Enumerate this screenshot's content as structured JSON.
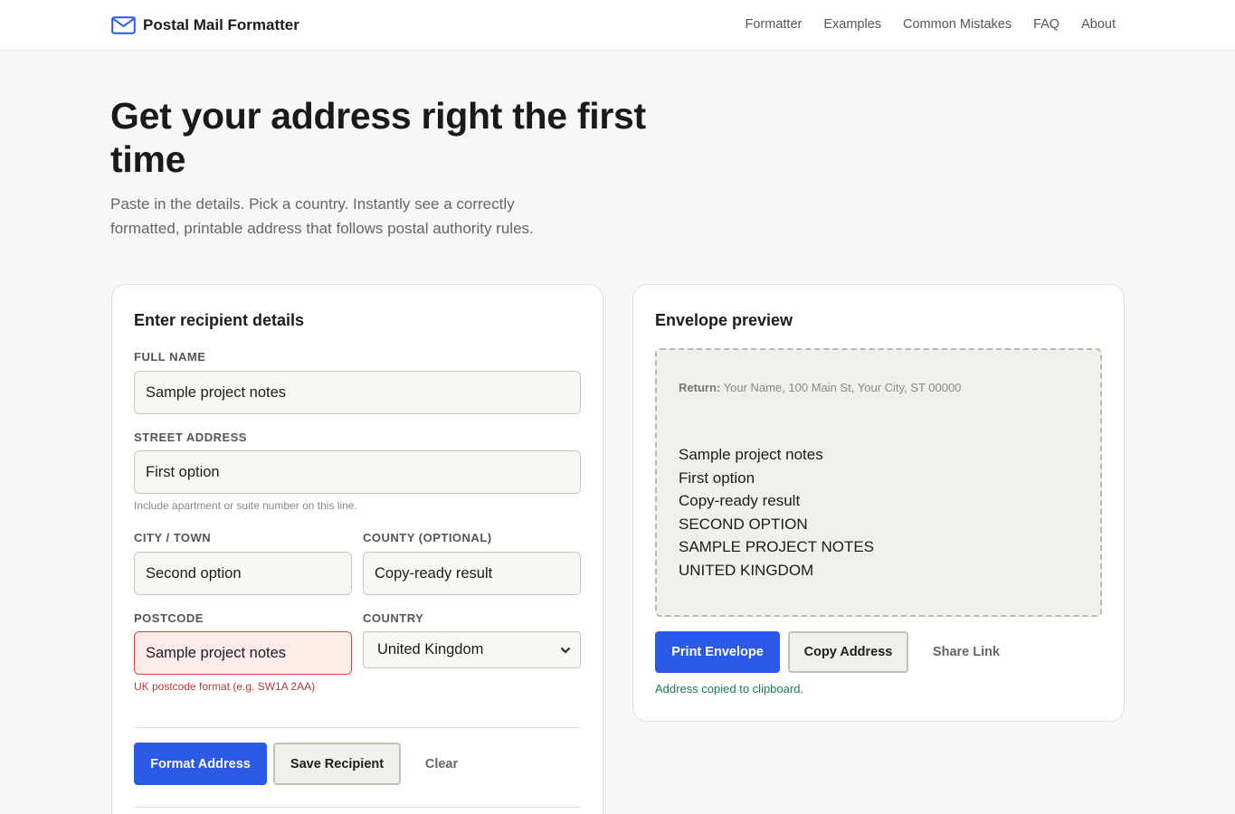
{
  "header": {
    "brand": "Postal Mail Formatter",
    "nav": [
      "Formatter",
      "Examples",
      "Common Mistakes",
      "FAQ",
      "About"
    ]
  },
  "hero": {
    "title": "Get your address right the first time",
    "subtitle": "Paste in the details. Pick a country. Instantly see a correctly formatted, printable address that follows postal authority rules."
  },
  "form": {
    "title": "Enter recipient details",
    "full_name": {
      "label": "Full Name",
      "value": "Sample project notes"
    },
    "street": {
      "label": "Street Address",
      "value": "First option",
      "hint": "Include apartment or suite number on this line."
    },
    "city": {
      "label": "City / Town",
      "value": "Second option"
    },
    "county": {
      "label": "County (optional)",
      "value": "Copy-ready result"
    },
    "postcode": {
      "label": "Postcode",
      "value": "Sample project notes",
      "error": "UK postcode format (e.g. SW1A 2AA)"
    },
    "country": {
      "label": "Country",
      "value": "United Kingdom"
    },
    "buttons": {
      "format": "Format Address",
      "save": "Save Recipient",
      "clear": "Clear"
    }
  },
  "preview": {
    "title": "Envelope preview",
    "return_label": "Return:",
    "return_value": "Your Name, 100 Main St, Your City, ST 00000",
    "lines": [
      "Sample project notes",
      "First option",
      "Copy-ready result",
      "SECOND OPTION",
      "SAMPLE PROJECT NOTES",
      "UNITED KINGDOM"
    ],
    "buttons": {
      "print": "Print Envelope",
      "copy": "Copy Address",
      "share": "Share Link"
    },
    "status": "Address copied to clipboard."
  },
  "colors": {
    "primary": "#2a5ae6",
    "error": "#b03a30",
    "success": "#1f7a46"
  },
  "icons": {
    "brand": "envelope-icon",
    "select": "chevron-down-icon"
  }
}
